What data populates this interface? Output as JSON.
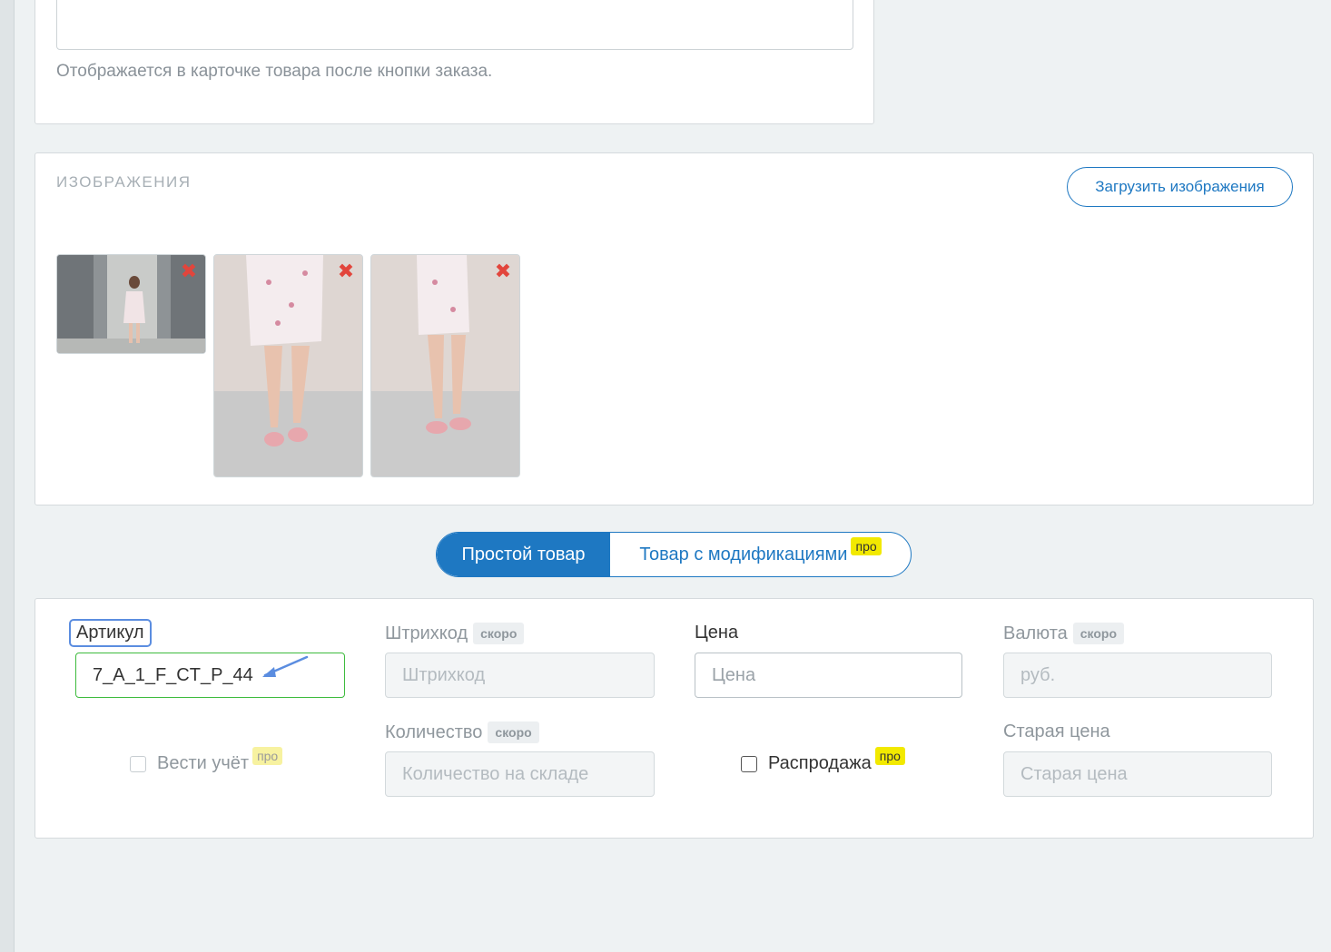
{
  "description_card": {
    "hint": "Отображается в карточке товара после кнопки заказа."
  },
  "images_card": {
    "title": "ИЗОБРАЖЕНИЯ",
    "upload_button": "Загрузить изображения",
    "remove_glyph": "✖",
    "thumbnails": [
      "image-1",
      "image-2",
      "image-3"
    ]
  },
  "product_type_toggle": {
    "simple": "Простой товар",
    "with_modifications": "Товар с модификациями",
    "pro_badge": "про"
  },
  "fields": {
    "sku": {
      "label": "Артикул",
      "value": "7_A_1_F_CT_P_44"
    },
    "barcode": {
      "label": "Штрихкод",
      "badge": "скоро",
      "placeholder": "Штрихкод"
    },
    "price": {
      "label": "Цена",
      "placeholder": "Цена"
    },
    "currency": {
      "label": "Валюта",
      "badge": "скоро",
      "value": "руб."
    },
    "track_stock": {
      "label": "Вести учёт",
      "badge": "про"
    },
    "quantity": {
      "label": "Количество",
      "badge": "скоро",
      "placeholder": "Количество на складе"
    },
    "sale": {
      "label": "Распродажа",
      "badge": "про"
    },
    "old_price": {
      "label": "Старая цена",
      "placeholder": "Старая цена"
    }
  },
  "colors": {
    "accent": "#1e78c2",
    "pro_badge": "#f2e900",
    "valid_border": "#3dbb3d",
    "remove": "#e2453c"
  }
}
